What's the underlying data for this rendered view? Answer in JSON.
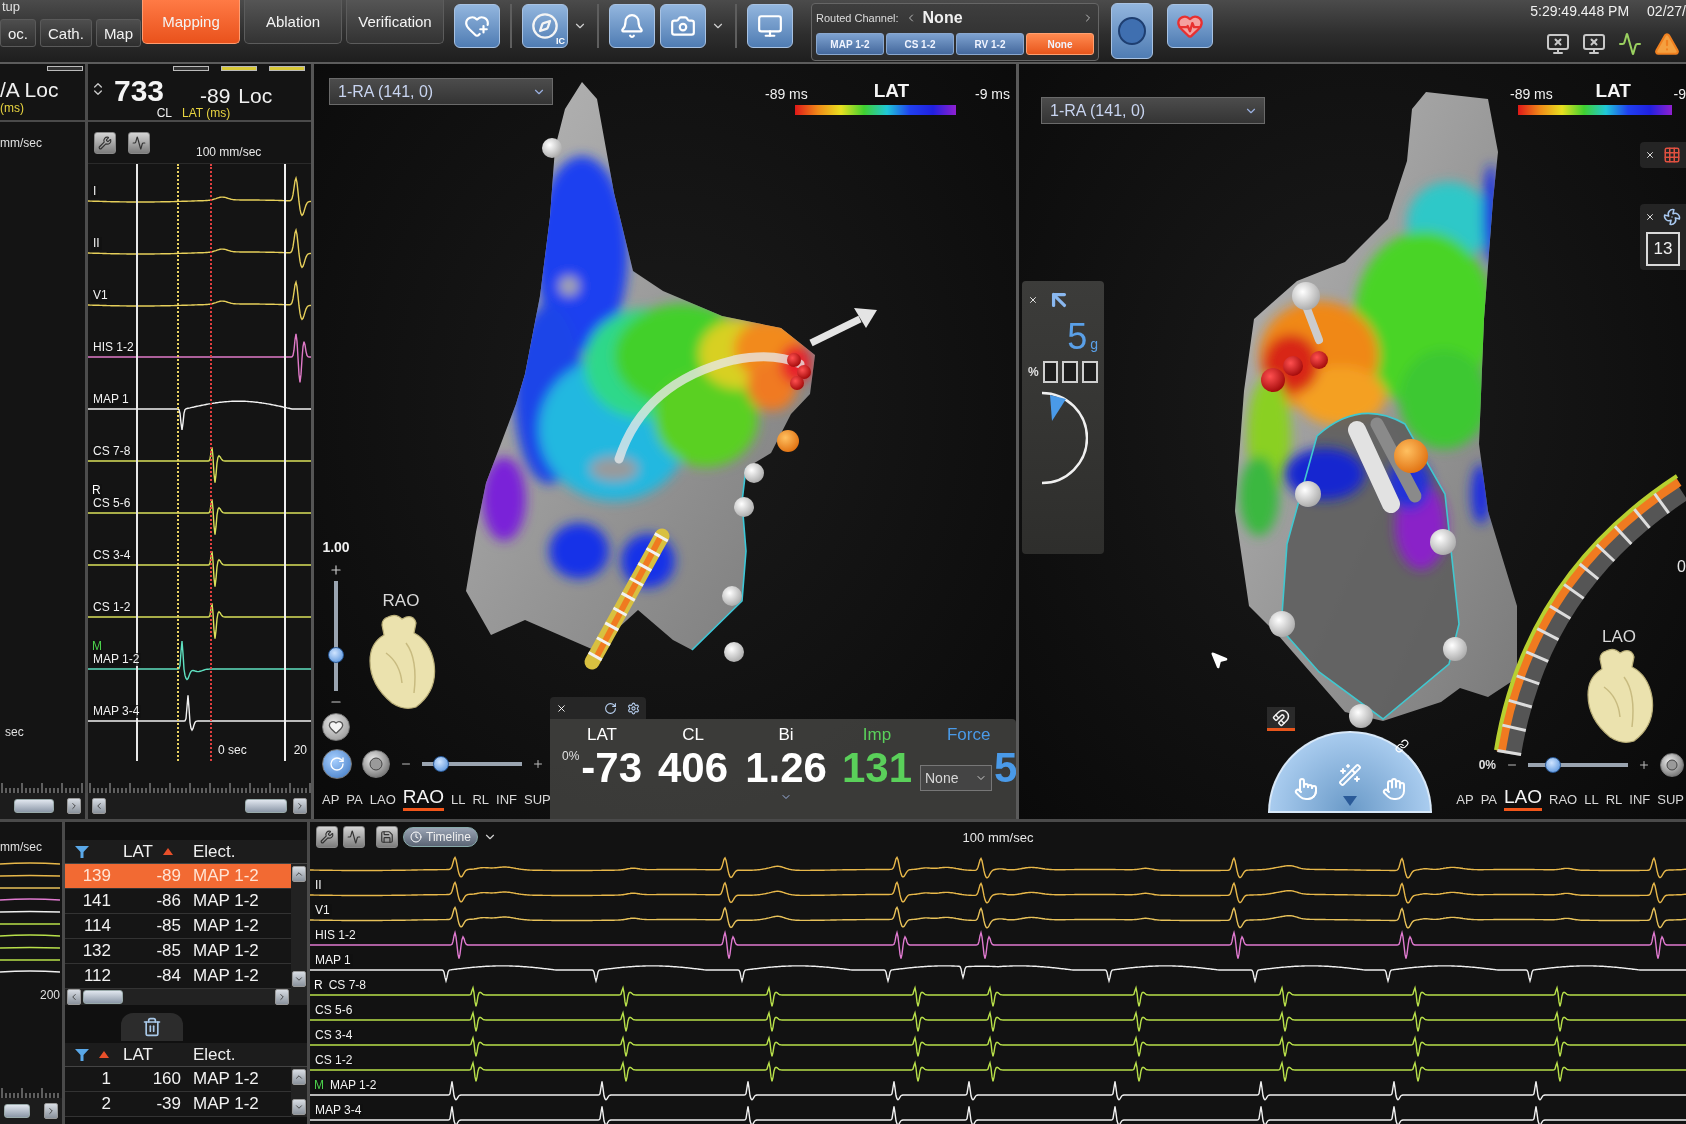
{
  "top_bar": {
    "corner_label": "tup",
    "sub_tabs": [
      {
        "label": "oc.",
        "selected": false
      },
      {
        "label": "Cath.",
        "selected": false
      },
      {
        "label": "Map",
        "selected": false
      }
    ],
    "tabs": [
      {
        "label": "Mapping",
        "selected": true
      },
      {
        "label": "Ablation",
        "selected": false
      },
      {
        "label": "Verification",
        "selected": false
      }
    ],
    "compass_badge": "IC",
    "routed_channel": {
      "label": "Routed Channel:",
      "value": "None",
      "channels": [
        {
          "label": "MAP 1-2",
          "selected": false
        },
        {
          "label": "CS 1-2",
          "selected": false
        },
        {
          "label": "RV 1-2",
          "selected": false
        },
        {
          "label": "None",
          "selected": true
        }
      ]
    },
    "clock": {
      "time": "5:29:49.448 PM",
      "date": "02/27/"
    }
  },
  "left_strip": {
    "title": "/A Loc",
    "unit": "(ms)",
    "speed": "mm/sec",
    "time": "sec"
  },
  "signal_panel": {
    "cl_value": "733",
    "cl_label": "CL",
    "lat_value": "-89",
    "mode": "Loc",
    "lat_label": "LAT (ms)",
    "speed": "100 mm/sec",
    "time": "0 sec",
    "scale": "20",
    "channels": [
      {
        "label": "I",
        "kind": "surface",
        "color": "#e6cf5a"
      },
      {
        "label": "II",
        "kind": "surface",
        "color": "#e6cf5a"
      },
      {
        "label": "V1",
        "kind": "surface",
        "color": "#e6cf5a"
      },
      {
        "label": "HIS 1-2",
        "kind": "his",
        "color": "#e07ac8"
      },
      {
        "label": "MAP 1",
        "kind": "unipolar",
        "color": "#f2f2f2"
      },
      {
        "label": "CS 7-8",
        "kind": "bipolar",
        "color": "#d9e05a"
      },
      {
        "label": "CS 5-6",
        "tag": {
          "text": "R",
          "color": "#ffffff"
        },
        "kind": "bipolar",
        "color": "#d9e05a"
      },
      {
        "label": "CS 3-4",
        "kind": "bipolar",
        "color": "#d9e05a"
      },
      {
        "label": "CS 1-2",
        "kind": "bipolar",
        "color": "#d9e05a"
      },
      {
        "label": "MAP 1-2",
        "tag": {
          "text": "M",
          "color": "#4cd04c"
        },
        "kind": "far",
        "color": "#5fe0c0"
      },
      {
        "label": "MAP 3-4",
        "kind": "spike",
        "color": "#f2f2f2"
      }
    ]
  },
  "left_map": {
    "map_select": "1-RA (141, 0)",
    "lat_min": "-89 ms",
    "lat_title": "LAT",
    "lat_max": "-9 ms",
    "zoom": {
      "value": "1.00",
      "level": 0.3
    },
    "rotate_slider": {
      "level": 0.13
    },
    "orientation": "RAO",
    "views": [
      {
        "label": "AP",
        "selected": false
      },
      {
        "label": "PA",
        "selected": false
      },
      {
        "label": "LAO",
        "selected": false
      },
      {
        "label": "RAO",
        "selected": true
      },
      {
        "label": "LL",
        "selected": false
      },
      {
        "label": "RL",
        "selected": false
      },
      {
        "label": "INF",
        "selected": false
      },
      {
        "label": "SUP",
        "selected": false
      }
    ],
    "stats": {
      "opacity": "0%",
      "filter": "None",
      "items": [
        {
          "label": "LAT",
          "value": "-73",
          "color": "#ffffff"
        },
        {
          "label": "CL",
          "value": "406",
          "color": "#ffffff"
        },
        {
          "label": "Bi",
          "value": "1.26",
          "color": "#ffffff"
        },
        {
          "label": "Imp",
          "value": "131",
          "color": "#5ad05a"
        },
        {
          "label": "Force",
          "value": "5",
          "color": "#4a9ae8"
        }
      ]
    }
  },
  "force_panel": {
    "value": "5",
    "unit": "g",
    "percent_label": "%"
  },
  "right_map": {
    "map_select": "1-RA (141, 0)",
    "lat_min": "-89 ms",
    "lat_title": "LAT",
    "lat_max": "-9",
    "count": "13",
    "edge_label": "0",
    "orientation": "LAO",
    "transparency": {
      "value": "0%",
      "level": 0.2
    },
    "views": [
      {
        "label": "AP",
        "selected": false
      },
      {
        "label": "PA",
        "selected": false
      },
      {
        "label": "LAO",
        "selected": true
      },
      {
        "label": "RAO",
        "selected": false
      },
      {
        "label": "LL",
        "selected": false
      },
      {
        "label": "RL",
        "selected": false
      },
      {
        "label": "INF",
        "selected": false
      },
      {
        "label": "SUP",
        "selected": false
      }
    ]
  },
  "mini_strip": {
    "speed": "mm/sec",
    "scale": "200"
  },
  "point_table": {
    "columns": [
      "LAT",
      "Elect."
    ],
    "rows": [
      {
        "point": "139",
        "lat": "-89",
        "electrode": "MAP 1-2",
        "selected": true
      },
      {
        "point": "141",
        "lat": "-86",
        "electrode": "MAP 1-2",
        "selected": false
      },
      {
        "point": "114",
        "lat": "-85",
        "electrode": "MAP 1-2",
        "selected": false
      },
      {
        "point": "132",
        "lat": "-85",
        "electrode": "MAP 1-2",
        "selected": false
      },
      {
        "point": "112",
        "lat": "-84",
        "electrode": "MAP 1-2",
        "selected": false
      }
    ]
  },
  "deleted_table": {
    "columns": [
      "LAT",
      "Elect."
    ],
    "rows": [
      {
        "point": "1",
        "lat": "160",
        "electrode": "MAP 1-2",
        "selected": false
      },
      {
        "point": "2",
        "lat": "-39",
        "electrode": "MAP 1-2",
        "selected": false
      }
    ]
  },
  "timeline": {
    "button": "Timeline",
    "speed": "100 mm/sec",
    "channels": [
      {
        "kind": "surface",
        "color": "#e8b84a"
      },
      {
        "label": "II",
        "kind": "surface",
        "color": "#e8b84a"
      },
      {
        "label": "V1",
        "kind": "surface",
        "color": "#e8c25a"
      },
      {
        "label": "HIS 1-2",
        "kind": "his",
        "color": "#e07ad0"
      },
      {
        "label": "MAP 1",
        "kind": "unipolar",
        "color": "#f0f0f0"
      },
      {
        "label": "CS 7-8",
        "tag": {
          "text": "R",
          "color": "#ffffff"
        },
        "kind": "bipolar",
        "color": "#b8e04a"
      },
      {
        "label": "CS 5-6",
        "kind": "bipolar",
        "color": "#b8e04a"
      },
      {
        "label": "CS 3-4",
        "kind": "bipolar",
        "color": "#b8e04a"
      },
      {
        "label": "CS 1-2",
        "kind": "bipolar",
        "color": "#b8e04a"
      },
      {
        "label": "MAP 1-2",
        "tag": {
          "text": "M",
          "color": "#4cd04c"
        },
        "kind": "spike",
        "color": "#f0f0f0"
      },
      {
        "label": "MAP 3-4",
        "kind": "spike",
        "color": "#f0f0f0"
      }
    ]
  }
}
